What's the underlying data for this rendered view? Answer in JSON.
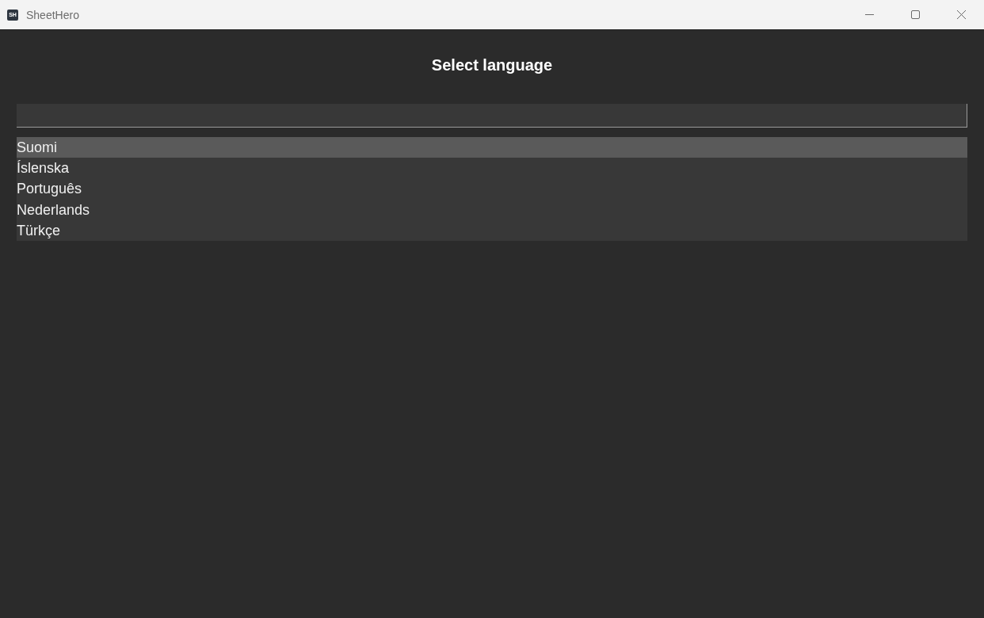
{
  "window": {
    "title": "SheetHero",
    "app_icon_text": "SH"
  },
  "heading": "Select language",
  "languages": [
    {
      "label": "Suomi",
      "selected": true
    },
    {
      "label": "Íslenska",
      "selected": false
    },
    {
      "label": "Português",
      "selected": false
    },
    {
      "label": "Nederlands",
      "selected": false
    },
    {
      "label": "Türkçe",
      "selected": false
    }
  ]
}
